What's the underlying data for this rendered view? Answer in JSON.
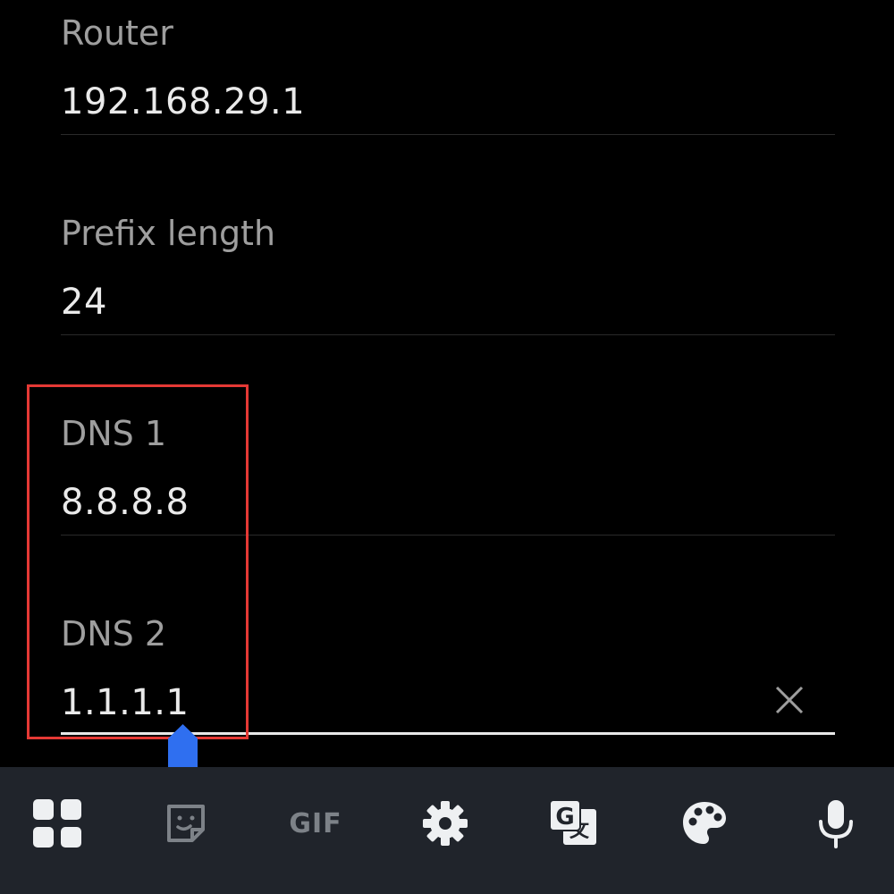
{
  "form": {
    "router": {
      "label": "Router",
      "value": "192.168.29.1"
    },
    "prefix": {
      "label": "Prefix length",
      "value": "24"
    },
    "dns1": {
      "label": "DNS 1",
      "value": "8.8.8.8"
    },
    "dns2": {
      "label": "DNS 2",
      "value": "1.1.1.1"
    }
  },
  "toolbar": {
    "items": [
      {
        "icon": "apps-grid-icon"
      },
      {
        "icon": "sticker-icon"
      },
      {
        "icon": "gif-icon",
        "label": "GIF"
      },
      {
        "icon": "gear-icon"
      },
      {
        "icon": "translate-icon"
      },
      {
        "icon": "palette-icon"
      },
      {
        "icon": "microphone-icon"
      }
    ]
  },
  "colors": {
    "background": "#000000",
    "label": "#9e9e9e",
    "value": "#eaeaea",
    "divider": "#2a2a2a",
    "active_underline": "#e8e8e8",
    "highlight": "#e53935",
    "cursor_handle": "#2f6ff0",
    "toolbar_bg": "#20242b",
    "toolbar_icon": "#eef0f2",
    "toolbar_icon_dim": "#7d8288"
  }
}
